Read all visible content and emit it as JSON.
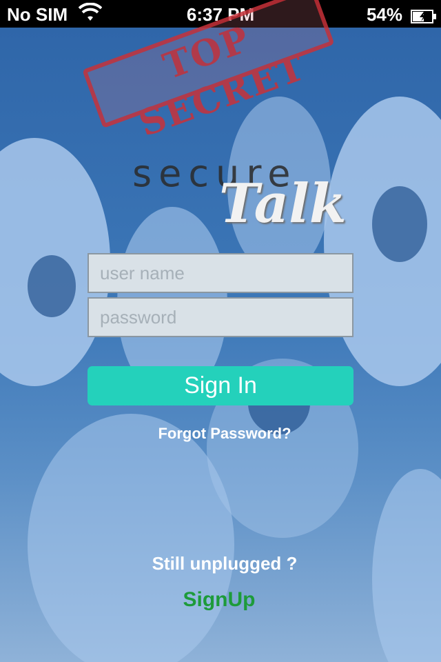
{
  "status_bar": {
    "carrier": "No SIM",
    "time": "6:37 PM",
    "battery_percent": "54%",
    "wifi_icon": "wifi-icon",
    "battery_icon": "battery-charging-icon"
  },
  "logo": {
    "stamp_text": "TOP SECRET",
    "word_secure": "secure",
    "word_talk": "Talk"
  },
  "form": {
    "username_placeholder": "user name",
    "username_value": "",
    "password_placeholder": "password",
    "password_value": "",
    "signin_label": "Sign In",
    "forgot_label": "Forgot Password?"
  },
  "footer": {
    "prompt": "Still unplugged ?",
    "signup_label": "SignUp"
  },
  "colors": {
    "accent": "#24d1bb",
    "signup": "#1d9b3a",
    "stamp": "#c8323a",
    "background": "#2d64a8"
  }
}
